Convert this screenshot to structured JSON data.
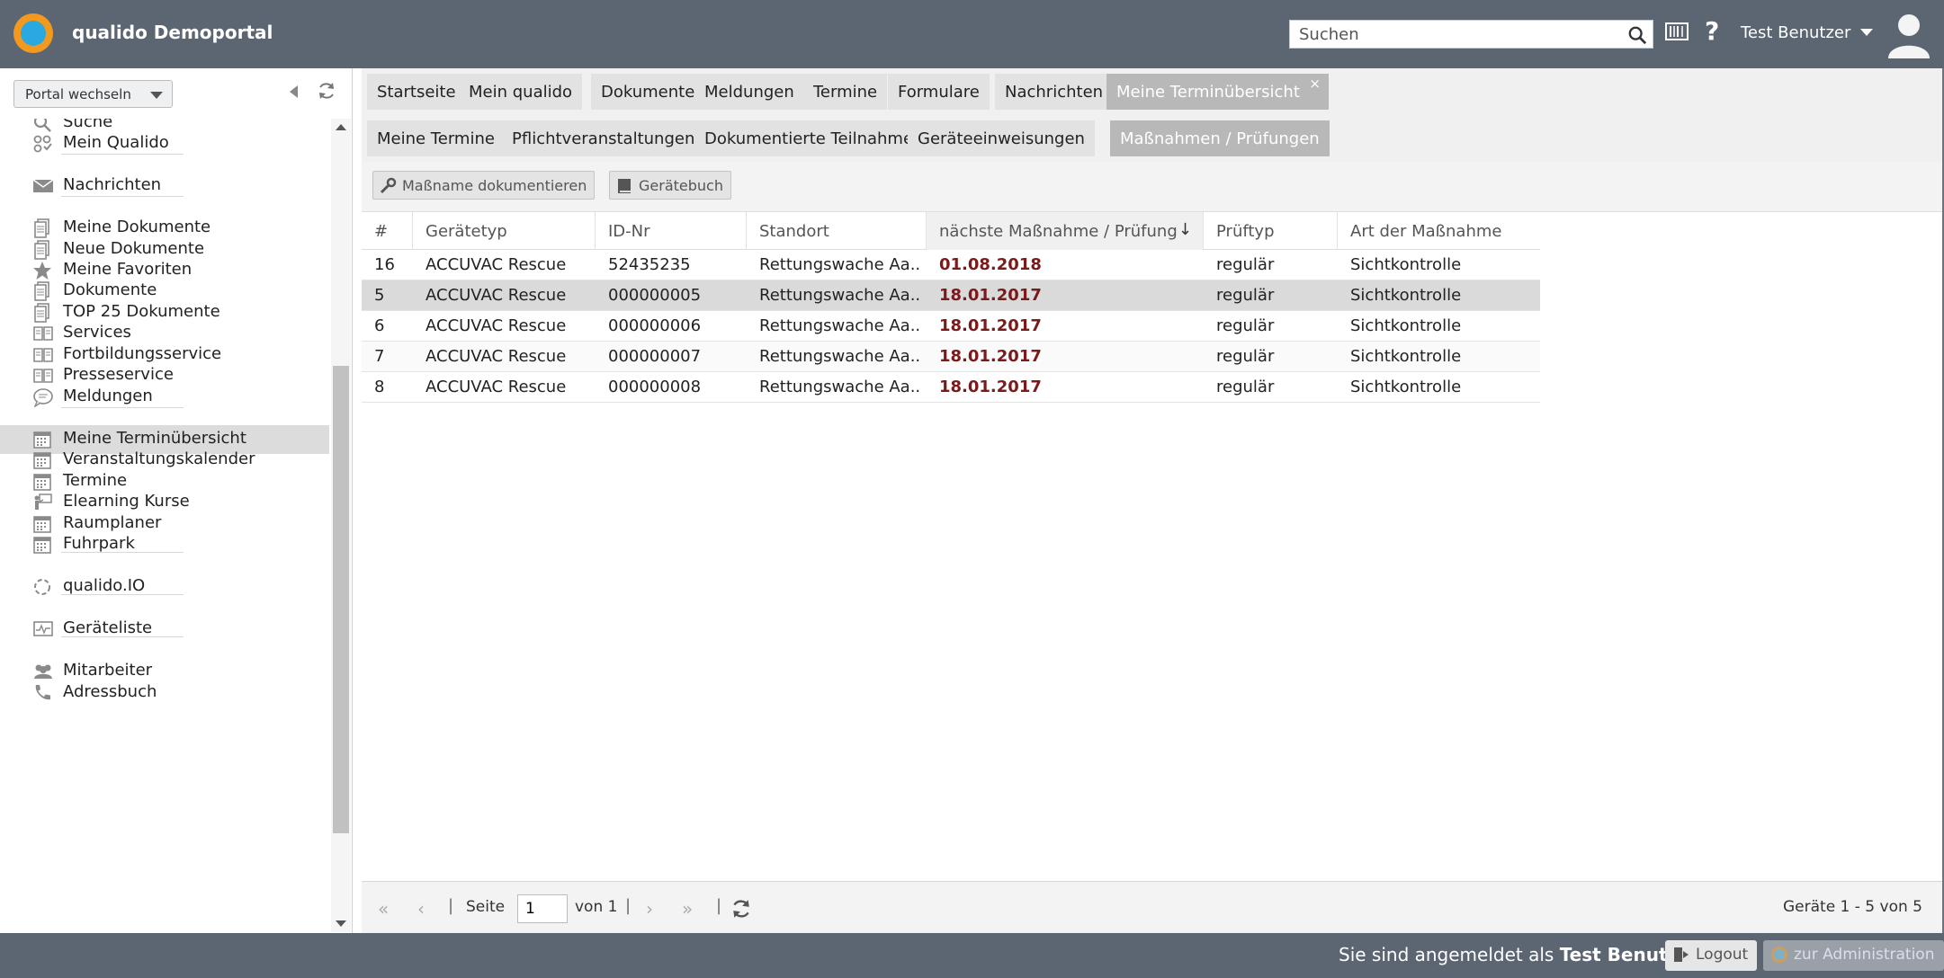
{
  "header": {
    "app_title": "qualido Demoportal",
    "search_placeholder": "Suchen",
    "user_name": "Test Benutzer"
  },
  "sidebar": {
    "portal_switch": "Portal wechseln",
    "items": [
      {
        "label": "Suche",
        "icon": "search-icon"
      },
      {
        "label": "Mein Qualido",
        "icon": "mein-qualido-icon"
      },
      {
        "label": "Nachrichten",
        "icon": "envelope-icon"
      },
      {
        "label": "Meine Dokumente",
        "icon": "document-icon"
      },
      {
        "label": "Neue Dokumente",
        "icon": "document-icon"
      },
      {
        "label": "Meine Favoriten",
        "icon": "star-icon"
      },
      {
        "label": "Dokumente",
        "icon": "document-icon"
      },
      {
        "label": "TOP 25 Dokumente",
        "icon": "document-icon"
      },
      {
        "label": "Services",
        "icon": "book-icon"
      },
      {
        "label": "Fortbildungsservice",
        "icon": "book-icon"
      },
      {
        "label": "Presseservice",
        "icon": "book-icon"
      },
      {
        "label": "Meldungen",
        "icon": "speech-bubble-icon"
      },
      {
        "label": "Meine Terminübersicht",
        "icon": "calendar-icon"
      },
      {
        "label": "Veranstaltungskalender",
        "icon": "calendar-icon"
      },
      {
        "label": "Termine",
        "icon": "calendar-icon"
      },
      {
        "label": "Elearning Kurse",
        "icon": "presentation-icon"
      },
      {
        "label": "Raumplaner",
        "icon": "calendar-icon"
      },
      {
        "label": "Fuhrpark",
        "icon": "calendar-icon"
      },
      {
        "label": "qualido.IO",
        "icon": "circle-dots-icon"
      },
      {
        "label": "Geräteliste",
        "icon": "monitor-icon"
      },
      {
        "label": "Mitarbeiter",
        "icon": "people-icon"
      },
      {
        "label": "Adressbuch",
        "icon": "phone-icon"
      }
    ]
  },
  "tabs_main": [
    "Startseite",
    "Mein qualido",
    "Dokumente",
    "Meldungen",
    "Termine",
    "Formulare",
    "Nachrichten",
    "Meine Terminübersicht"
  ],
  "tabs_sub": [
    "Meine Termine",
    "Pflichtveranstaltungen",
    "Dokumentierte Teilnahmen",
    "Geräteeinweisungen",
    "Maßnahmen / Prüfungen"
  ],
  "toolbar": {
    "document_button": "Maßname dokumentieren",
    "logbook_button": "Gerätebuch"
  },
  "grid": {
    "columns": [
      "#",
      "Gerätetyp",
      "ID-Nr",
      "Standort",
      "nächste Maßnahme / Prüfung",
      "Prüftyp",
      "Art der Maßnahme"
    ],
    "rows": [
      [
        "16",
        "ACCUVAC Rescue",
        "52435235",
        "Rettungswache Aa...",
        "01.08.2018",
        "regulär",
        "Sichtkontrolle"
      ],
      [
        "5",
        "ACCUVAC Rescue",
        "000000005",
        "Rettungswache Aa...",
        "18.01.2017",
        "regulär",
        "Sichtkontrolle"
      ],
      [
        "6",
        "ACCUVAC Rescue",
        "000000006",
        "Rettungswache Aa...",
        "18.01.2017",
        "regulär",
        "Sichtkontrolle"
      ],
      [
        "7",
        "ACCUVAC Rescue",
        "000000007",
        "Rettungswache Aa...",
        "18.01.2017",
        "regulär",
        "Sichtkontrolle"
      ],
      [
        "8",
        "ACCUVAC Rescue",
        "000000008",
        "Rettungswache Aa...",
        "18.01.2017",
        "regulär",
        "Sichtkontrolle"
      ]
    ],
    "selected_row": 1
  },
  "pager": {
    "page_label": "Seite",
    "page_value": "1",
    "of_label": "von 1",
    "info": "Geräte 1 - 5 von 5"
  },
  "footer": {
    "signed_in_prefix": "Sie sind angemeldet als",
    "signed_in_user": "Test Benutzer",
    "logout": "Logout",
    "admin": "zur Administration"
  },
  "colors": {
    "header_bg": "#5c6572",
    "overdue_date": "#7a1a1a",
    "active_tab": "#b8b8b8"
  }
}
